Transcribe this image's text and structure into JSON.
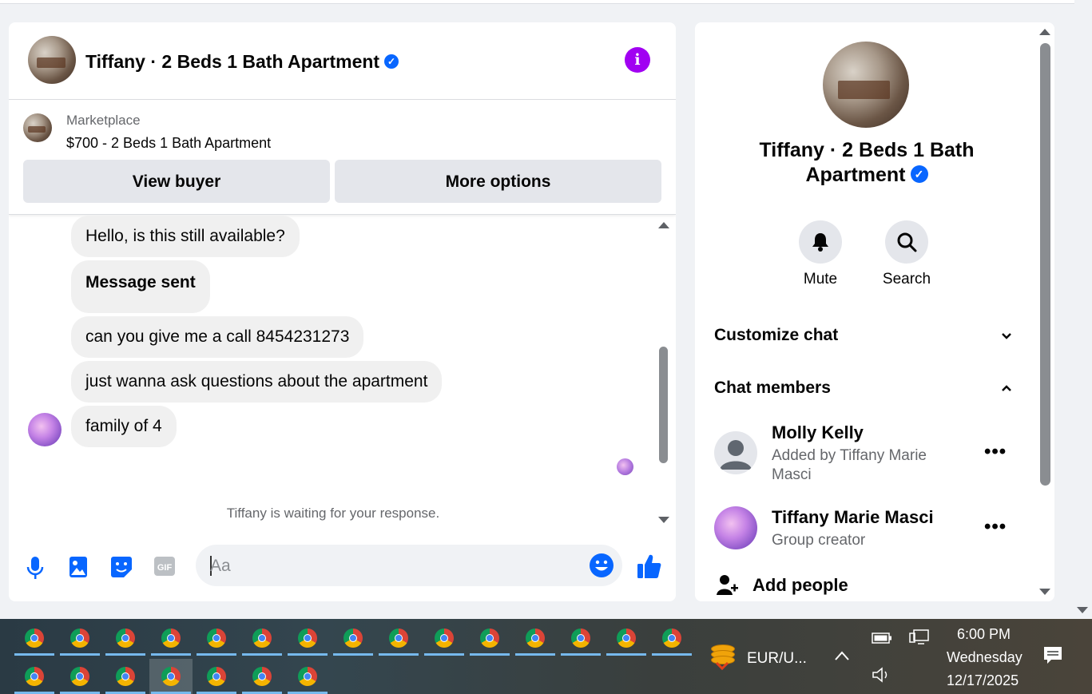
{
  "chat": {
    "header_title": "Tiffany · 2 Beds 1 Bath Apartment",
    "marketplace_label": "Marketplace",
    "listing": "$700 - 2 Beds 1 Bath Apartment",
    "view_buyer": "View buyer",
    "more_options": "More options",
    "messages": [
      "Hello, is this still available?",
      "Message sent",
      "can you give me a call 8454231273",
      "just wanna ask questions about the apartment",
      "family of 4"
    ],
    "waiting": "Tiffany is waiting for your response.",
    "input_placeholder": "Aa",
    "icons": [
      "microphone-icon",
      "photo-icon",
      "sticker-icon",
      "gif-icon",
      "emoji-icon",
      "like-icon"
    ]
  },
  "info": {
    "title": "Tiffany · 2 Beds 1 Bath Apartment",
    "mute": "Mute",
    "search": "Search",
    "customize_chat": "Customize chat",
    "chat_members": "Chat members",
    "members": [
      {
        "name": "Molly Kelly",
        "sub": "Added by Tiffany Marie Masci"
      },
      {
        "name": "Tiffany Marie Masci",
        "sub": "Group creator"
      }
    ],
    "add_people": "Add people"
  },
  "taskbar": {
    "ticker": "EUR/U...",
    "time": "6:00 PM",
    "day": "Wednesday",
    "date": "12/17/2025"
  },
  "colors": {
    "accent": "#0866ff",
    "info_purple": "#a100f2",
    "bubble": "#f0f0f0",
    "background": "#f0f2f5"
  }
}
